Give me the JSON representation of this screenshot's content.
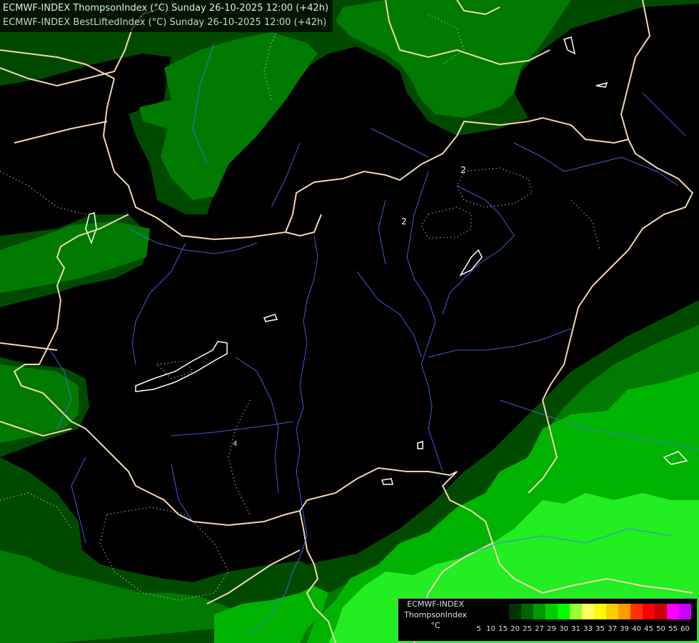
{
  "header": {
    "line1": "ECMWF-INDEX ThompsonIndex (°C) Sunday 26-10-2025 12:00 (+42h)",
    "line2": "ECMWF-INDEX BestLiftedIndex (°C) Sunday 26-10-2025 12:00 (+42h)"
  },
  "legend": {
    "title": "ECMWF-INDEX",
    "variable": "ThompsonIndex",
    "unit": "°C",
    "ticks": [
      "5",
      "10",
      "15",
      "20",
      "25",
      "27",
      "29",
      "30",
      "31",
      "33",
      "35",
      "37",
      "39",
      "40",
      "45",
      "50",
      "55",
      "60"
    ],
    "colors": [
      "#000000",
      "#000000",
      "#000000",
      "#003300",
      "#006600",
      "#009900",
      "#00cc00",
      "#00ff00",
      "#99ff33",
      "#ffff66",
      "#ffff00",
      "#ffcc00",
      "#ff9900",
      "#ff3300",
      "#ff0000",
      "#cc0000",
      "#ff00ff",
      "#cc00ff",
      "#9900ff",
      "#6600ff",
      "#0000ff"
    ]
  },
  "map": {
    "contour_labels": [
      "2",
      "2",
      "4"
    ],
    "colors": {
      "background": "#000000",
      "dark_green": "#004a00",
      "medium_green": "#007a00",
      "green": "#00b300",
      "bright_green": "#22ee22",
      "border": "#f3d7ae",
      "river": "#4a6cff",
      "lake": "#ffffff"
    }
  }
}
